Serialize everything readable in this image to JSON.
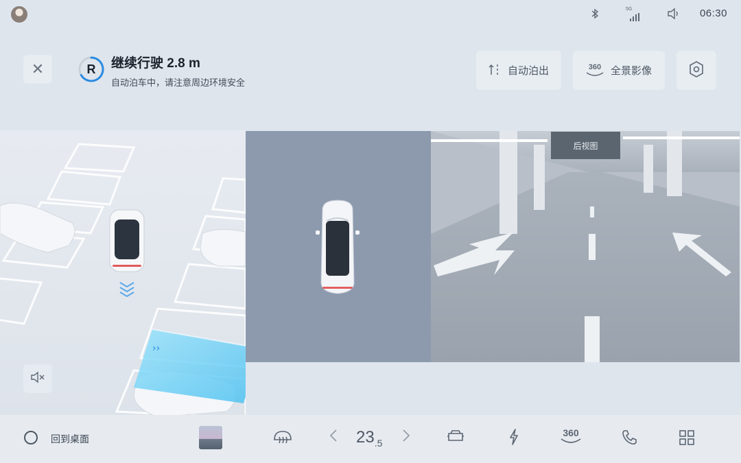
{
  "status_bar": {
    "network": "5G",
    "time": "06:30"
  },
  "parking": {
    "gear": "R",
    "title": "继续行驶 2.8 m",
    "subtitle": "自动泊车中，请注意周边环境安全",
    "park_out_label": "自动泊出",
    "surround_label": "全景影像",
    "surround_icon_text": "360"
  },
  "camera": {
    "label": "后视图"
  },
  "dock": {
    "home_label": "回到桌面",
    "temperature_main": "23",
    "temperature_decimal": ".5",
    "view360_text": "360"
  },
  "icons": {
    "bluetooth": "bluetooth-icon",
    "signal": "signal-icon",
    "volume": "volume-icon",
    "mute": "mute-icon",
    "settings": "settings-icon",
    "defrost": "rear-defrost-icon",
    "seat": "seat-icon",
    "charge": "lightning-icon",
    "phone": "phone-icon",
    "apps": "apps-grid-icon"
  },
  "colors": {
    "accent": "#2a8be0",
    "highlight": "#6ccff5"
  }
}
